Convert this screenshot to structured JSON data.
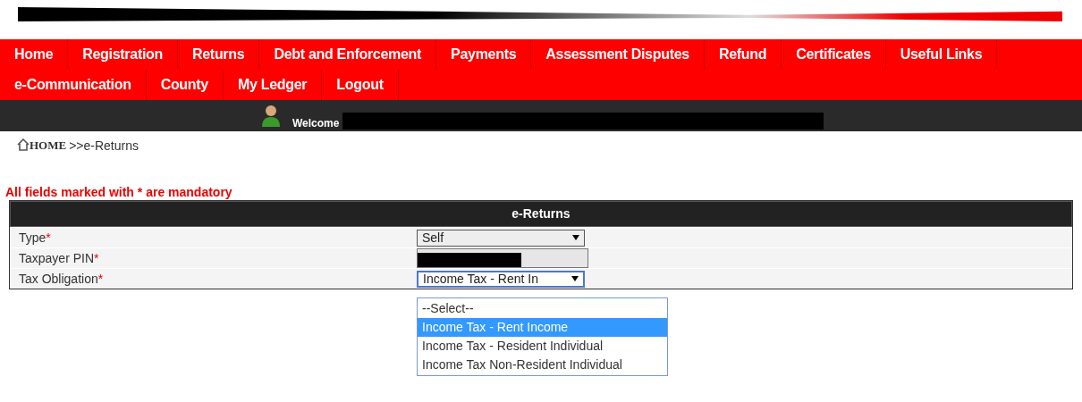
{
  "nav": [
    {
      "label": "Home"
    },
    {
      "label": "Registration"
    },
    {
      "label": "Returns"
    },
    {
      "label": "Debt and Enforcement"
    },
    {
      "label": "Payments"
    },
    {
      "label": "Assessment Disputes"
    },
    {
      "label": "Refund"
    },
    {
      "label": "Certificates"
    },
    {
      "label": "Useful Links"
    },
    {
      "label": "e-Communication"
    },
    {
      "label": "County"
    },
    {
      "label": "My Ledger"
    },
    {
      "label": "Logout"
    }
  ],
  "welcome": "Welcome",
  "breadcrumb": {
    "home": "HOME",
    "current": ">>e-Returns"
  },
  "notice": "All fields marked with * are mandatory",
  "form": {
    "title": "e-Returns",
    "fields": [
      {
        "kind": "select",
        "label": "Type",
        "required_mark": "*",
        "value": "Self"
      },
      {
        "kind": "text",
        "label": "Taxpayer PIN",
        "required_mark": "*"
      },
      {
        "kind": "select",
        "label": "Tax Obligation",
        "required_mark": "*",
        "value": "Income Tax - Rent In",
        "focused": true
      }
    ]
  },
  "dropdown": {
    "options": [
      {
        "label": "--Select--",
        "selected": false
      },
      {
        "label": "Income Tax - Rent Income",
        "selected": true
      },
      {
        "label": "Income Tax - Resident Individual",
        "selected": false
      },
      {
        "label": "Income Tax Non-Resident Individual",
        "selected": false
      }
    ]
  }
}
